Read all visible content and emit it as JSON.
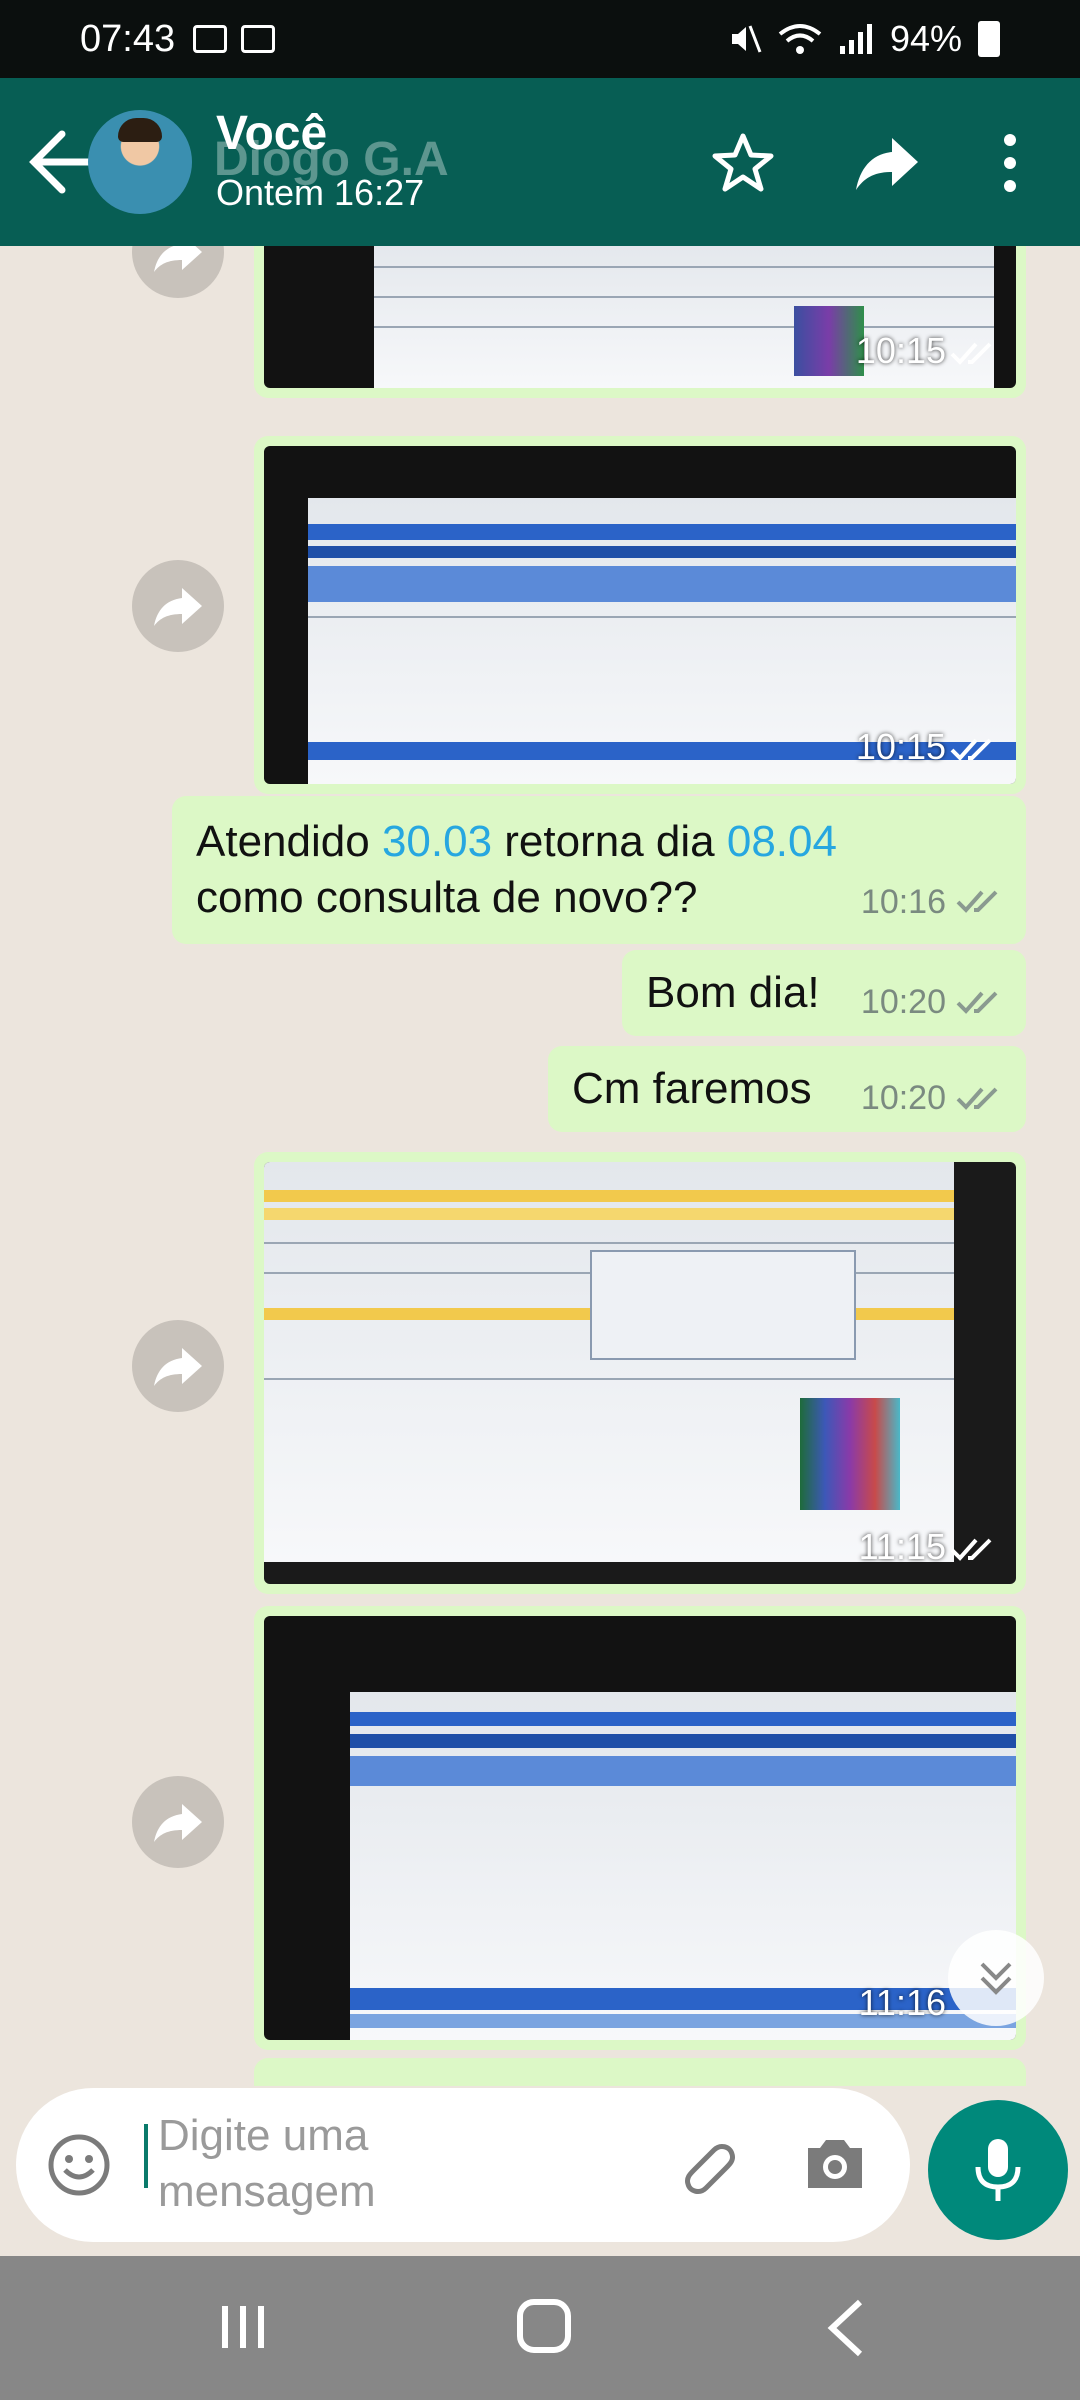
{
  "status_bar": {
    "time": "07:43",
    "battery": "94%"
  },
  "header": {
    "name": "Você",
    "ghost_name": "Diogo G.A",
    "subtitle": "Ontem 16:27"
  },
  "messages": [
    {
      "type": "image",
      "time": "10:15"
    },
    {
      "type": "image",
      "time": "10:15"
    },
    {
      "type": "text",
      "line1_pre": "Atendido ",
      "line1_link1": "30.03",
      "line1_mid": " retorna dia ",
      "line1_link2": "08.04",
      "line2": "como consulta de novo??",
      "time": "10:16"
    },
    {
      "type": "text",
      "text": "Bom dia!",
      "time": "10:20"
    },
    {
      "type": "text",
      "text": "Cm faremos",
      "time": "10:20"
    },
    {
      "type": "image",
      "time": "11:15"
    },
    {
      "type": "image",
      "time": "11:16"
    }
  ],
  "input": {
    "placeholder": "Digite uma mensagem"
  },
  "colors": {
    "header": "#075e54",
    "bubble": "#dcf8c6",
    "link": "#27a7e0",
    "mic": "#00897b"
  }
}
